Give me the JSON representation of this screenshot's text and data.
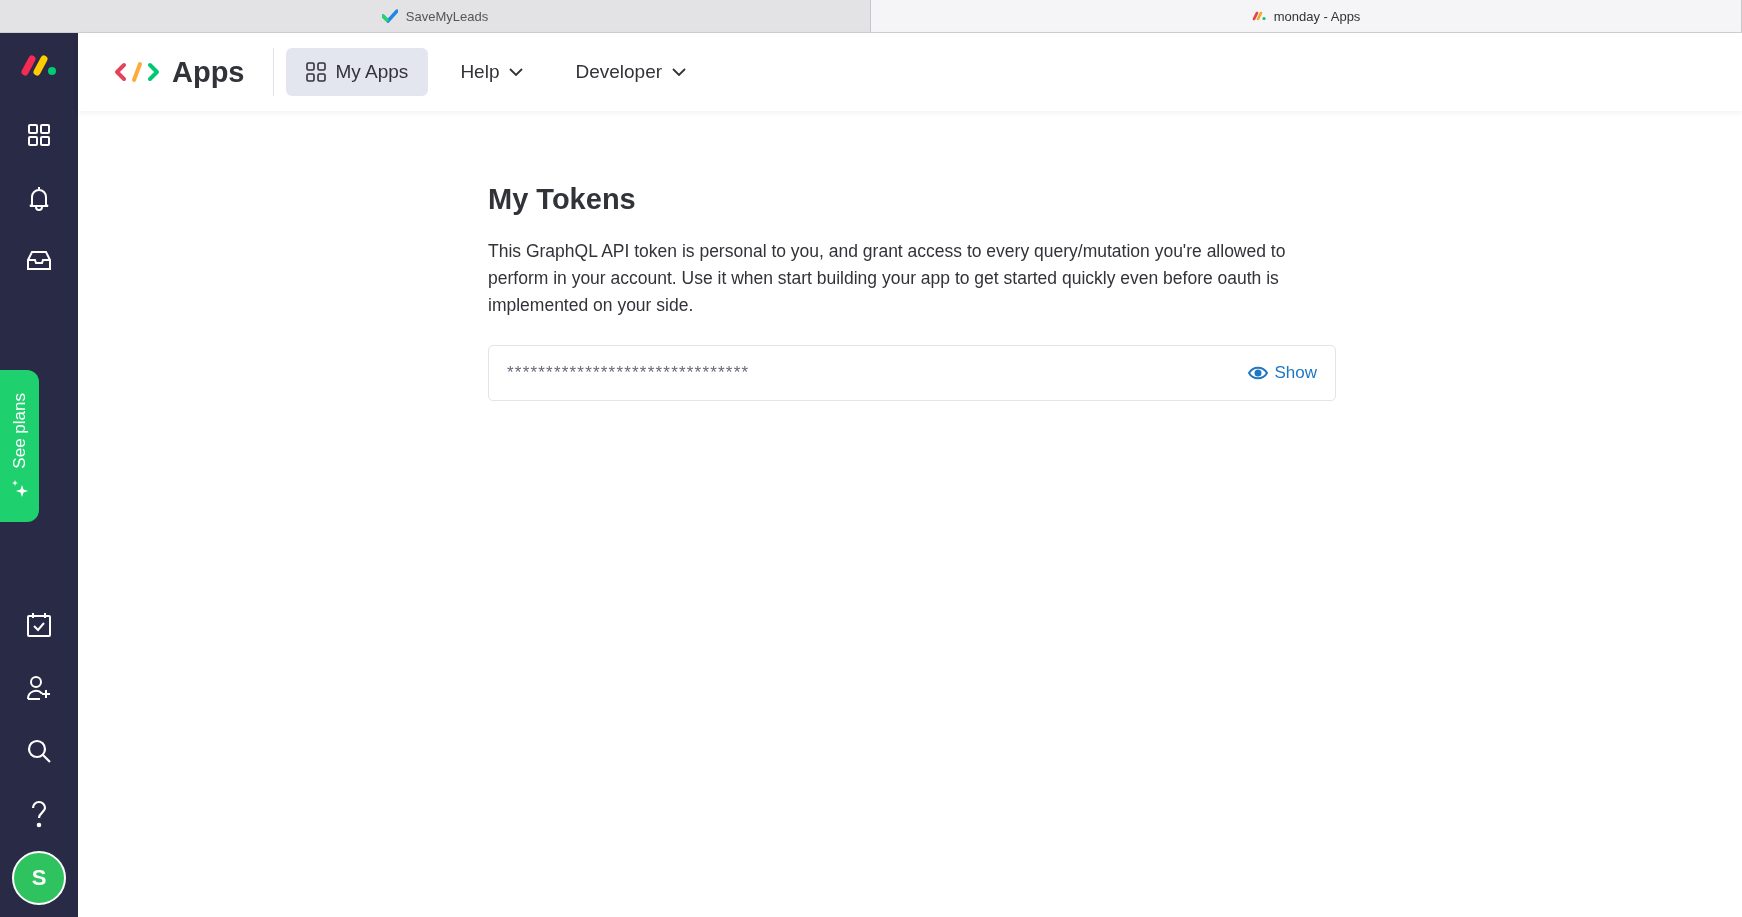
{
  "browser_tabs": [
    {
      "title": "SaveMyLeads",
      "selected": false
    },
    {
      "title": "monday - Apps",
      "selected": true
    }
  ],
  "sidebar": {
    "top_items": [
      {
        "kind": "grid"
      },
      {
        "kind": "bell"
      },
      {
        "kind": "inbox"
      }
    ],
    "promo": "See plans",
    "bottom_items": [
      {
        "kind": "calendar"
      },
      {
        "kind": "invite"
      },
      {
        "kind": "search"
      },
      {
        "kind": "help"
      }
    ],
    "avatar": "S"
  },
  "header": {
    "title": "Apps",
    "nav": [
      {
        "label": "My Apps",
        "selected": true,
        "dropdown": false
      },
      {
        "label": "Help",
        "selected": false,
        "dropdown": true
      },
      {
        "label": "Developer",
        "selected": false,
        "dropdown": true
      }
    ]
  },
  "page": {
    "title": "My Tokens",
    "description": "This GraphQL API token is personal to you, and grant access to every query/mutation you're allowed to perform in your account. Use it when start building your app to get started quickly even before oauth is implemented on your side.",
    "token": {
      "value": "*******************************",
      "action": "Show"
    }
  }
}
